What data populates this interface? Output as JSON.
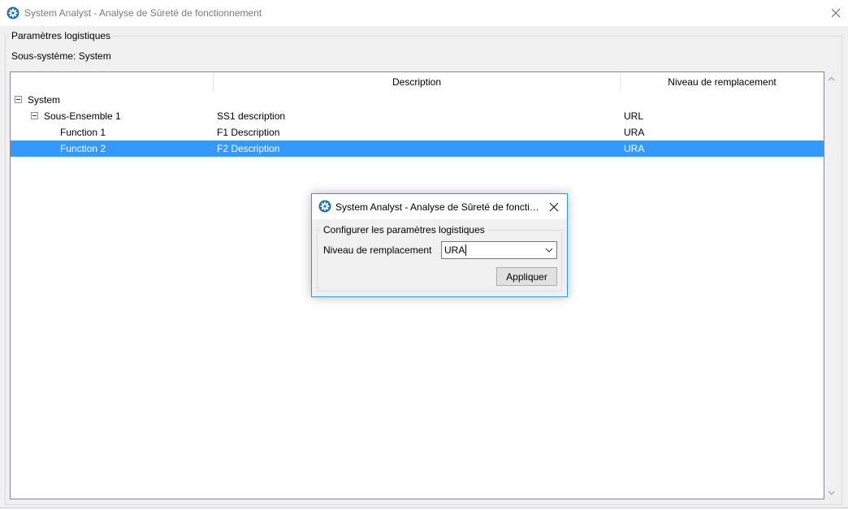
{
  "window": {
    "title": "System Analyst - Analyse de Sûreté de fonctionnement"
  },
  "group": {
    "legend": "Paramètres logistiques",
    "subsystem_label": "Sous-système: System"
  },
  "tree": {
    "headers": {
      "name": "",
      "description": "Description",
      "level": "Niveau de remplacement"
    },
    "rows": [
      {
        "name": "System",
        "description": "",
        "level": "",
        "depth": 0,
        "expanded": true,
        "selected": false
      },
      {
        "name": "Sous-Ensemble 1",
        "description": "SS1 description",
        "level": "URL",
        "depth": 1,
        "expanded": true,
        "selected": false
      },
      {
        "name": "Function 1",
        "description": "F1 Description",
        "level": "URA",
        "depth": 2,
        "selected": false
      },
      {
        "name": "Function 2",
        "description": "F2 Description",
        "level": "URA",
        "depth": 2,
        "selected": true
      }
    ]
  },
  "dialog": {
    "title": "System Analyst - Analyse de Sûreté de fonctio...",
    "group_legend": "Configurer les paramètres logistiques",
    "field_label": "Niveau de remplacement",
    "combo_value": "URA",
    "apply_label": "Appliquer"
  },
  "colors": {
    "selection": "#3399ff",
    "dialog_border": "#1ba1e2",
    "app_icon": "#1e6fb5"
  },
  "icons": {
    "app": "gear-icon",
    "close": "close-icon",
    "expander": "minus-box-icon",
    "combo_arrow": "chevron-down-icon",
    "scroll_up": "chevron-up-icon",
    "scroll_down": "chevron-down-icon"
  }
}
